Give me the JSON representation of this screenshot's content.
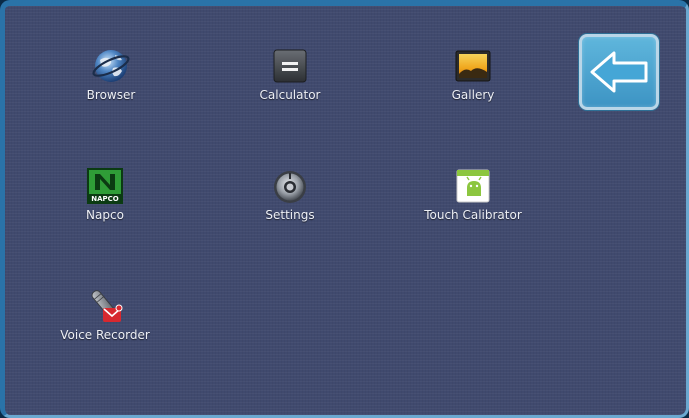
{
  "apps": [
    {
      "label": "Browser",
      "icon": "globe-icon"
    },
    {
      "label": "Calculator",
      "icon": "calculator-icon"
    },
    {
      "label": "Gallery",
      "icon": "gallery-icon"
    },
    {
      "label": "Napco",
      "icon": "napco-logo-icon",
      "icon_text": "NAPCO"
    },
    {
      "label": "Settings",
      "icon": "settings-knob-icon"
    },
    {
      "label": "Touch Calibrator",
      "icon": "android-calibrator-icon"
    },
    {
      "label": "Voice Recorder",
      "icon": "microphone-icon"
    }
  ],
  "back_button": {
    "icon": "back-arrow-icon"
  },
  "colors": {
    "background": "#404a6e",
    "frame": "#2a73a8",
    "label": "#eef0f6",
    "back_button": "#4aa3cf"
  }
}
